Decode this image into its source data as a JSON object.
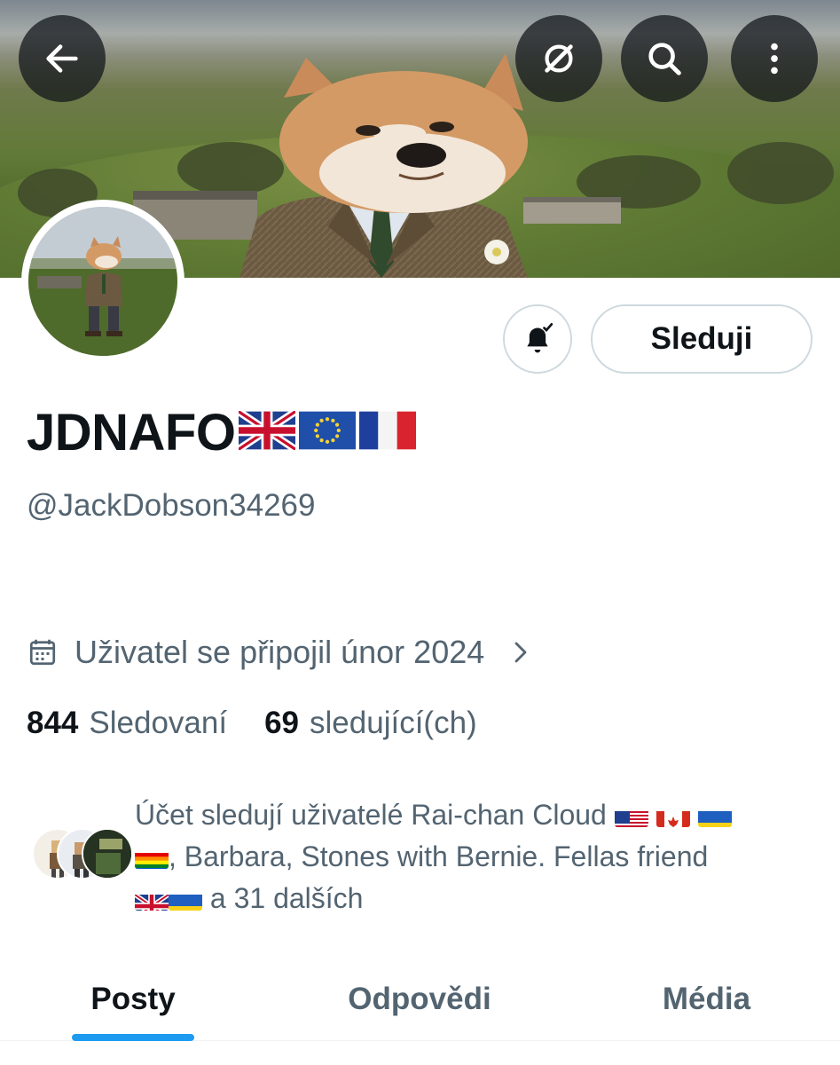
{
  "header": {
    "back_icon": "arrow-left-icon",
    "grok_icon": "grok-icon",
    "search_icon": "search-icon",
    "more_icon": "more-vertical-icon"
  },
  "profile": {
    "display_name": "JDNAFO",
    "name_flags": [
      "gb-flag",
      "eu-flag",
      "fr-flag"
    ],
    "handle": "@JackDobson34269",
    "joined": "Uživatel se připojil únor 2024",
    "following_count": "844",
    "following_label": "Sledovaní",
    "followers_count": "69",
    "followers_label": "sledující(ch)"
  },
  "actions": {
    "notify_icon": "bell-check-icon",
    "follow_label": "Sleduji"
  },
  "followed_by": {
    "line1": "Účet sledují uživatelé Rai-chan Cloud",
    "line2": ", Barbara, Stones with Bernie. Fellas friend",
    "line3": "a 31 dalších"
  },
  "tabs": [
    {
      "label": "Posty",
      "active": true
    },
    {
      "label": "Odpovědi",
      "active": false
    },
    {
      "label": "Média",
      "active": false
    }
  ],
  "colors": {
    "accent": "#1d9bf0",
    "text_primary": "#0f1419",
    "text_secondary": "#536471",
    "border": "#cfd9de"
  }
}
